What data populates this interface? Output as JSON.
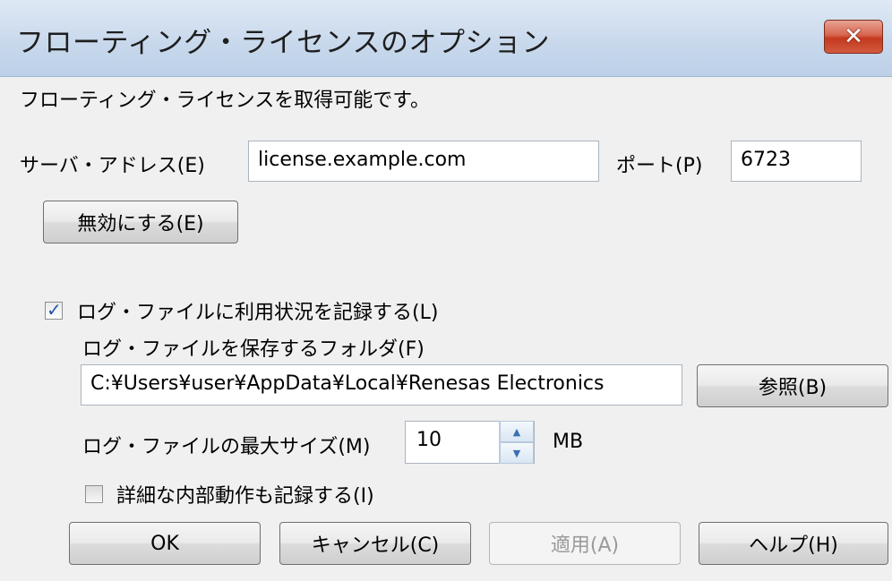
{
  "window": {
    "title": "フローティング・ライセンスのオプション",
    "close_label": "✕"
  },
  "status_text": "フローティング・ライセンスを取得可能です。",
  "server": {
    "address_label": "サーバ・アドレス(E)",
    "address_value": "license.example.com",
    "port_label": "ポート(P)",
    "port_value": "6723",
    "disable_button": "無効にする(E)"
  },
  "logging": {
    "enable_checkbox_label": "ログ・ファイルに利用状況を記録する(L)",
    "enable_checked": true,
    "folder_label": "ログ・ファイルを保存するフォルダ(F)",
    "folder_value": "C:¥Users¥user¥AppData¥Local¥Renesas Electronics",
    "browse_button": "参照(B)",
    "max_size_label": "ログ・ファイルの最大サイズ(M)",
    "max_size_value": "10",
    "max_size_unit": "MB",
    "detail_checkbox_label": "詳細な内部動作も記録する(I)",
    "detail_checked": false
  },
  "footer": {
    "ok_button": "OK",
    "cancel_button": "キャンセル(C)",
    "apply_button": "適用(A)",
    "help_button": "ヘルプ(H)"
  },
  "colors": {
    "titlebar": "#c9d9ec",
    "close_button": "#c4391f",
    "check_mark": "#2454a8"
  }
}
